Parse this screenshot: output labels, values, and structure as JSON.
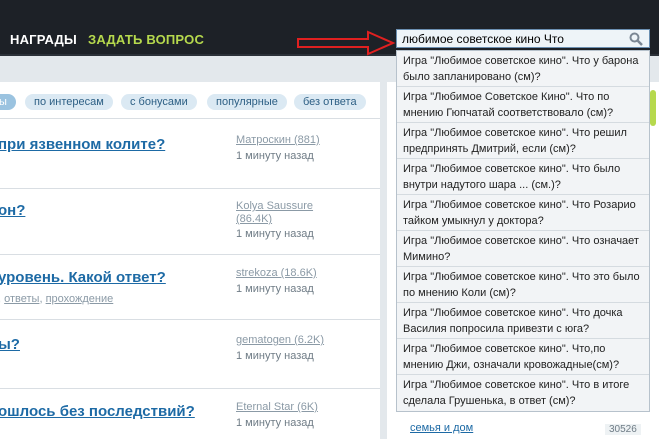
{
  "nav": {
    "awards": "НАГРАДЫ",
    "ask": "ЗАДАТЬ ВОПРОС"
  },
  "search": {
    "value": "любимое советское кино Что"
  },
  "filters": [
    {
      "label": "ы",
      "selected": true
    },
    {
      "label": "по интересам",
      "selected": false
    },
    {
      "label": "с бонусами",
      "selected": false
    },
    {
      "label": "популярные",
      "selected": false
    },
    {
      "label": "без ответа",
      "selected": false
    }
  ],
  "questions": [
    {
      "title": "при язвенном колите?",
      "user": "Матроскин (881)",
      "time": "1 минуту назад"
    },
    {
      "title": "он?",
      "user": "Kolya Saussure",
      "user2": "(86.4K)",
      "time": "1 минуту назад"
    },
    {
      "title": "уровень. Какой ответ?",
      "user": "strekoza (18.6K)",
      "time": "1 минуту назад",
      "sub": [
        ", ",
        "ответы",
        ", ",
        "прохождение"
      ]
    },
    {
      "title": "ы?",
      "user": "gematogen (6.2K)",
      "time": "1 минуту назад"
    },
    {
      "title": "ошлось без последствий?",
      "user": "Eternal Star (6K)",
      "time": "1 минуту назад"
    }
  ],
  "suggestions": [
    "Игра \"Любимое советское кино\". Что у барона было запланировано (см)?",
    "Игра \"Любимое Советское Кино\". Что по мнению Гюпчатай соответствовало (см)?",
    "Игра \"Любимое советское кино\". Что решил предпринять Дмитрий, если (см)?",
    "Игра \"Любимое советское кино\". Что было внутри надутого шара ... (см.)?",
    "Игра \"Любимое советское кино\". Что Розарио тайком умыкнул у доктора?",
    "Игра \"Любимое советское кино\". Что означает Мимино?",
    "Игра \"Любимое советское кино\". Что это было по мнению Коли (см)?",
    "Игра \"Любимое советское кино\". Что дочка Василия попросила привезти с юга?",
    "Игра \"Любимое советское кино\". Что,по мнению Джи, означали кровожадные(см)?",
    "Игра \"Любимое советское кино\". Что в итоге сделала Грушенька, в ответ (см)?"
  ],
  "sidebar": {
    "link": "семья и дом",
    "count": "30526"
  },
  "colors": {
    "topbar": "#1d2127",
    "accent_green": "#b6d94d",
    "link_blue": "#1d6aa5",
    "arrow_red": "#e02020"
  }
}
